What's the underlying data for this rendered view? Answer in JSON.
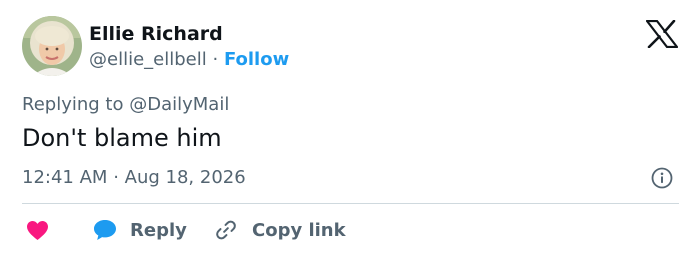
{
  "author": {
    "name": "Ellie Richard",
    "handle": "@ellie_ellbell",
    "separator": "·",
    "follow_label": "Follow"
  },
  "reply_context": {
    "prefix": "Replying to",
    "target_handle": "@DailyMail"
  },
  "tweet": {
    "text": "Don't blame him",
    "time": "12:41 AM",
    "separator": "·",
    "date": "Aug 18, 2026"
  },
  "actions": {
    "reply_label": "Reply",
    "copy_link_label": "Copy link"
  },
  "colors": {
    "accent": "#1d9bf0",
    "like": "#f91880",
    "muted_text": "#536471",
    "divider": "#cfd9de"
  },
  "icons": {
    "brand": "x-logo-icon",
    "info": "info-icon",
    "like": "heart-icon",
    "reply": "speech-bubble-icon",
    "copy_link": "link-icon"
  }
}
